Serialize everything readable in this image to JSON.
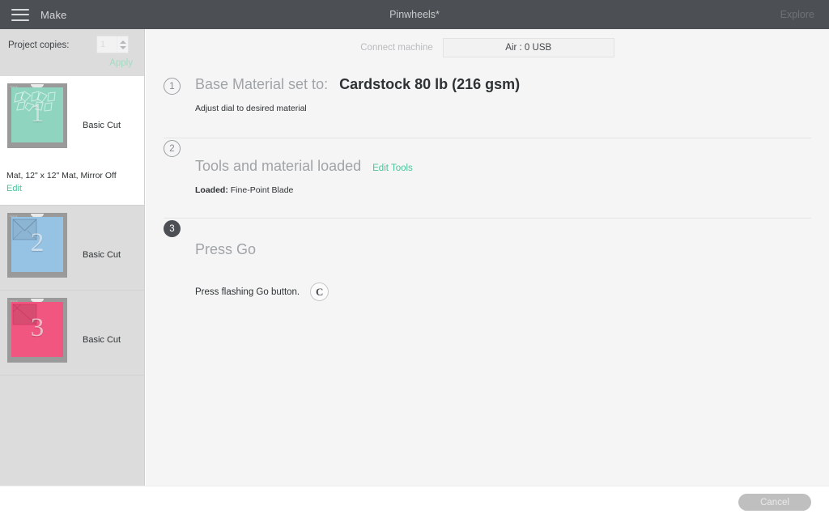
{
  "header": {
    "menu_icon": "hamburger-icon",
    "mode_label": "Make",
    "document_title": "Pinwheels*",
    "explore_label": "Explore"
  },
  "sidebar": {
    "copies_label": "Project copies:",
    "copies_value": "1",
    "copies_placeholder": "1",
    "apply_label": "Apply",
    "mats": [
      {
        "number": "1",
        "cut_label": "Basic Cut",
        "meta": "Mat, 12\" x 12\" Mat, Mirror Off",
        "edit_label": "Edit",
        "color": "#8fd4bf",
        "selected": true
      },
      {
        "number": "2",
        "cut_label": "Basic Cut",
        "meta": "",
        "edit_label": "",
        "color": "#96c3e4",
        "selected": false
      },
      {
        "number": "3",
        "cut_label": "Basic Cut",
        "meta": "",
        "edit_label": "",
        "color": "#f0567f",
        "selected": false
      }
    ]
  },
  "machine": {
    "connect_label": "Connect machine",
    "selected_machine": "Air : 0 USB"
  },
  "steps": [
    {
      "number": "1",
      "title": "Base Material set to:",
      "value": "Cardstock 80 lb (216 gsm)",
      "sub": "Adjust dial to desired material",
      "state": "hollow"
    },
    {
      "number": "2",
      "title": "Tools and material loaded",
      "action_label": "Edit Tools",
      "sub_label": "Loaded:",
      "sub_value": "Fine-Point Blade",
      "state": "hollow"
    },
    {
      "number": "3",
      "title": "Press Go",
      "go_text": "Press flashing Go button.",
      "go_icon": "cricut-c-icon",
      "state": "filled"
    }
  ],
  "footer": {
    "cancel_label": "Cancel"
  },
  "colors": {
    "accent_green": "#4ec49a",
    "header_bg": "#4c5054",
    "panel_bg": "#f5f5f5"
  }
}
